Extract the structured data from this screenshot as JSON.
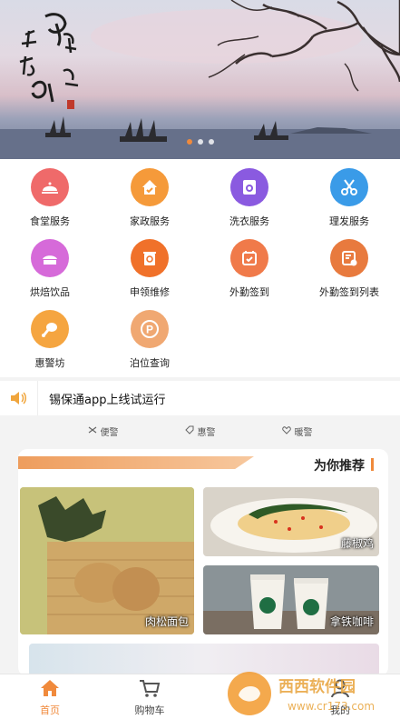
{
  "banner": {
    "calligraphy": "包吴越太湖多照",
    "active_slide": 1,
    "slide_count": 3
  },
  "services": [
    {
      "label": "食堂服务",
      "icon": "cloche-icon",
      "color": "#ef6a6a"
    },
    {
      "label": "家政服务",
      "icon": "house-icon",
      "color": "#f59a3a"
    },
    {
      "label": "洗衣服务",
      "icon": "washing-machine-icon",
      "color": "#8a5ae0"
    },
    {
      "label": "理发服务",
      "icon": "scissors-icon",
      "color": "#3a9be8"
    },
    {
      "label": "烘焙饮品",
      "icon": "cake-icon",
      "color": "#d66ad9"
    },
    {
      "label": "申领维修",
      "icon": "recycle-bin-icon",
      "color": "#f0712a"
    },
    {
      "label": "外勤签到",
      "icon": "calendar-check-icon",
      "color": "#f07a4a"
    },
    {
      "label": "外勤签到列表",
      "icon": "list-clock-icon",
      "color": "#e87a3e"
    },
    {
      "label": "惠警坊",
      "icon": "chicken-leg-icon",
      "color": "#f5a540"
    },
    {
      "label": "泊位查询",
      "icon": "parking-icon",
      "color": "#f0a872"
    }
  ],
  "notice": {
    "icon": "speaker-icon",
    "text": "锡保通app上线试运行"
  },
  "tags": [
    {
      "icon": "shuffle-icon",
      "label": "便警"
    },
    {
      "icon": "tag-icon",
      "label": "惠警"
    },
    {
      "icon": "heart-icon",
      "label": "暖警"
    }
  ],
  "recommend": {
    "title": "为你推荐",
    "items": [
      {
        "name": "肉松面包"
      },
      {
        "name": "藤椒鸡"
      },
      {
        "name": "拿铁咖啡"
      }
    ]
  },
  "tabbar": {
    "items": [
      {
        "label": "首页",
        "icon": "home-icon",
        "active": true
      },
      {
        "label": "购物车",
        "icon": "cart-icon",
        "active": false
      },
      {
        "label": "我的",
        "icon": "user-icon",
        "active": false
      }
    ]
  },
  "watermark": {
    "text": "西西软件园",
    "sub": "www.cr173.com"
  },
  "colors": {
    "accent": "#f08a3c"
  }
}
